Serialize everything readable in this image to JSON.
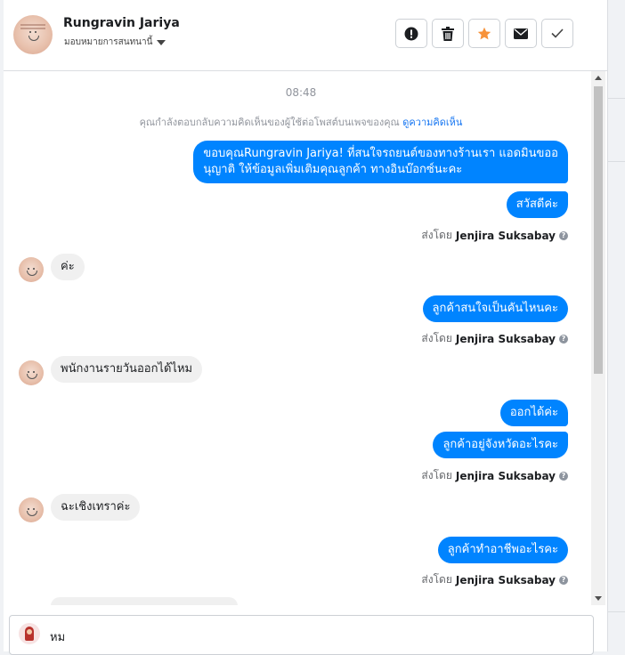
{
  "header": {
    "name": "Rungravin Jariya",
    "assign_label": "มอบหมายการสนทนานี้"
  },
  "actions": [
    {
      "icon": "spam-icon"
    },
    {
      "icon": "trash-icon"
    },
    {
      "icon": "star-icon",
      "color": "#f7923a"
    },
    {
      "icon": "envelope-icon"
    },
    {
      "icon": "check-icon"
    }
  ],
  "thread": {
    "time": "08:48",
    "notice": "คุณกำลังตอบกลับความคิดเห็นของผู้ใช้ต่อโพสต์บนเพจของคุณ",
    "notice_link": "ดูความคิดเห็น",
    "messages": {
      "m1_line1": "ขอบคุณRungravin Jariya! ที่สนใจรถยนต์ของทางร้านเรา แอดมินขออ",
      "m1_line2": "นุญาติ ให้ข้อมูลเพิ่มเติมคุณลูกค้า ทางอินบ๊อกซ์นะคะ",
      "m2": "สวัสดีค่ะ",
      "m3": "ค่ะ",
      "m4": "ลูกค้าสนใจเป็นคันไหนคะ",
      "m5": "พนักงานรายวันออกได้ไหม",
      "m6": "ออกได้ค่ะ",
      "m7": "ลูกค้าอยู่จังหวัดอะไรคะ",
      "m8": "ฉะเชิงเทราค่ะ",
      "m9": "ลูกค้าทำอาชีพอะไรคะ"
    },
    "sent_by_prefix": "ส่งโดย",
    "sent_by_name": "Jenjira Suksabay"
  },
  "composer": {
    "text": "หม"
  },
  "colors": {
    "outgoing": "#0084ff",
    "incoming": "#f0f0f0",
    "link": "#1877f2"
  }
}
